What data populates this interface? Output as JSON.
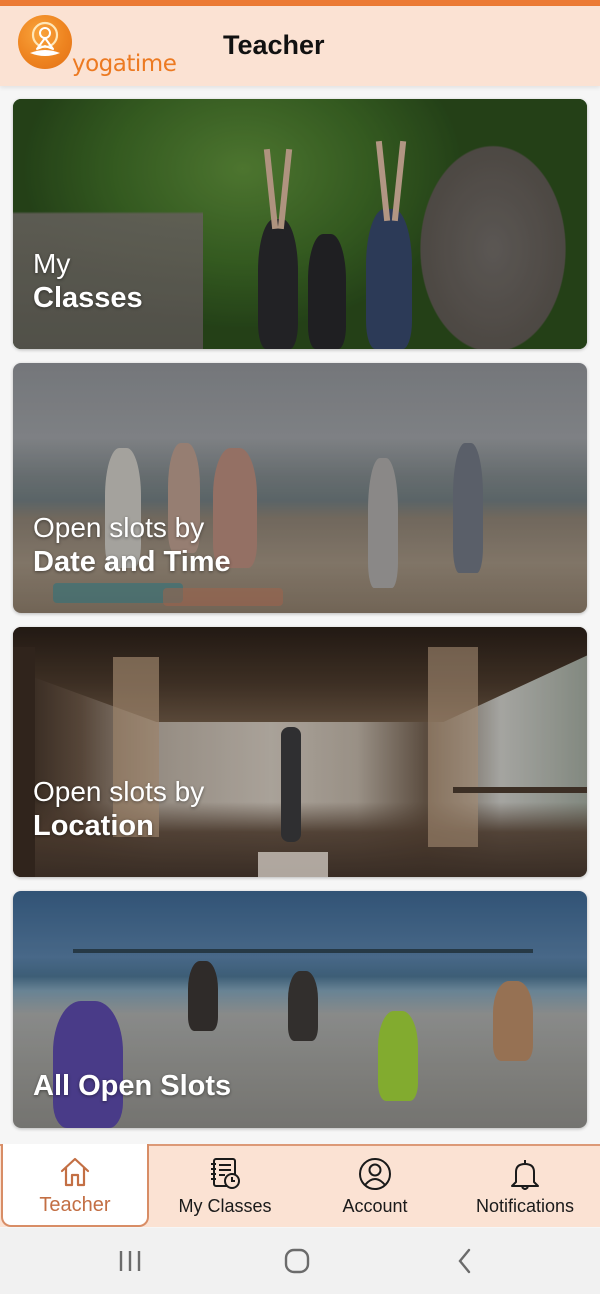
{
  "app": {
    "brand": "yogatime",
    "accent_color": "#ec7a34",
    "header_bg": "#fbe2d3"
  },
  "header": {
    "title": "Teacher"
  },
  "cards": [
    {
      "id": "my-classes",
      "line1": "My",
      "line2": "Classes",
      "image": "outdoor-yoga-stone-ruins"
    },
    {
      "id": "by-date-time",
      "line1": "Open slots by",
      "line2": "Date and Time",
      "image": "beach-yoga-tree-pose"
    },
    {
      "id": "by-location",
      "line1": "Open slots by",
      "line2": "Location",
      "image": "yoga-pavilion-headstand"
    },
    {
      "id": "all-open",
      "line1": "",
      "line2": "All Open Slots",
      "image": "beach-yoga-pier"
    }
  ],
  "bottom_nav": {
    "items": [
      {
        "label": "Teacher",
        "icon": "home-icon",
        "active": true
      },
      {
        "label": "My Classes",
        "icon": "schedule-notebook-icon",
        "active": false
      },
      {
        "label": "Account",
        "icon": "user-circle-icon",
        "active": false
      },
      {
        "label": "Notifications",
        "icon": "bell-icon",
        "active": false
      }
    ]
  },
  "system_nav": {
    "buttons": [
      "recent-apps",
      "home",
      "back"
    ]
  }
}
